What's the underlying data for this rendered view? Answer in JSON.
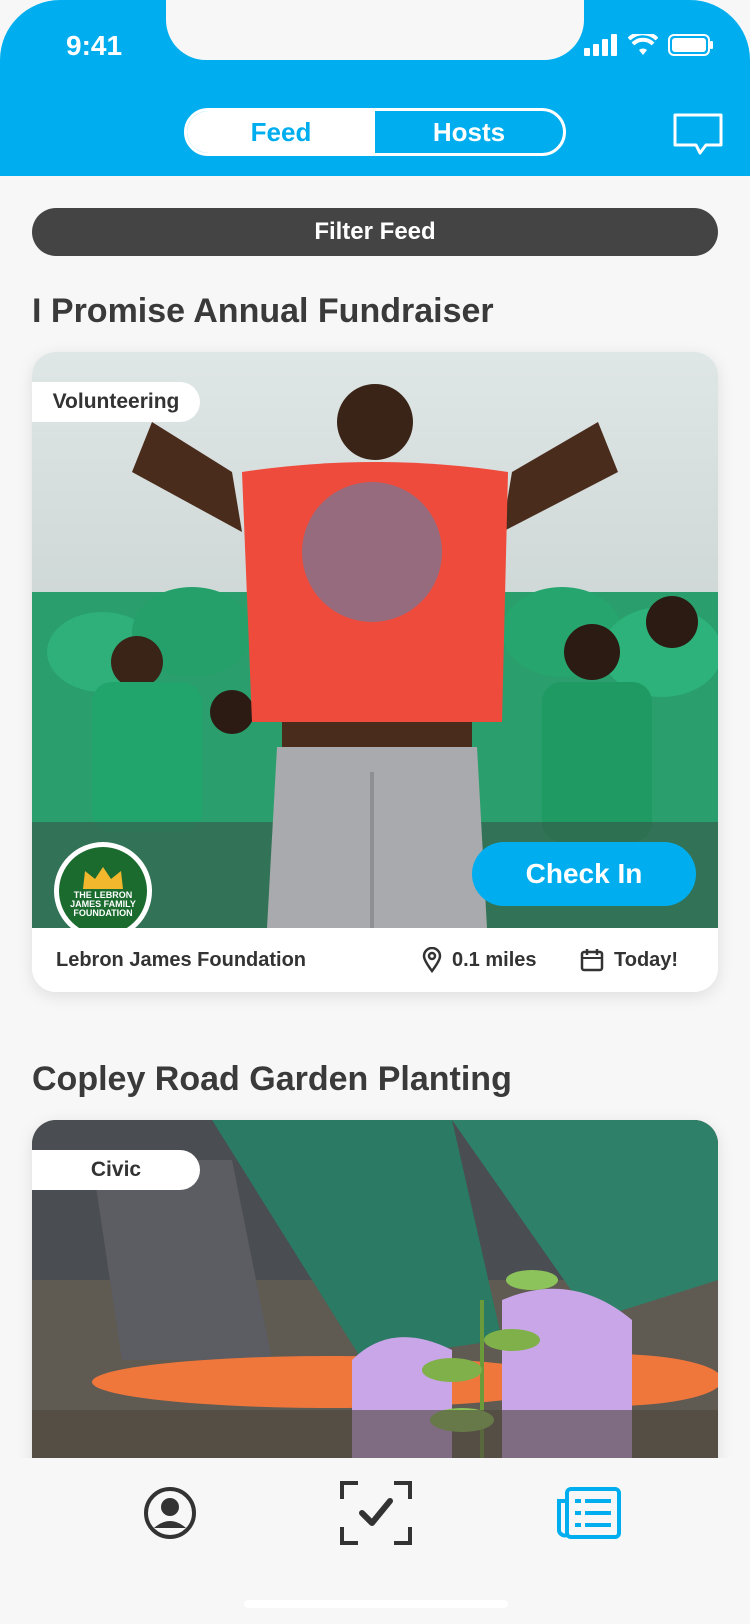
{
  "status_bar": {
    "time": "9:41"
  },
  "header": {
    "tabs": [
      {
        "label": "Feed",
        "active": true
      },
      {
        "label": "Hosts",
        "active": false
      }
    ],
    "message_icon": "chat-bubble-icon",
    "accent_color": "#00aeef"
  },
  "filter": {
    "label": "Filter Feed"
  },
  "events": [
    {
      "title": "I Promise Annual Fundraiser",
      "category": "Volunteering",
      "host_logo_text": [
        "THE LEBRON",
        "JAMES FAMILY",
        "FOUNDATION"
      ],
      "check_in_label": "Check In",
      "host": "Lebron James Foundation",
      "distance": "0.1 miles",
      "date": "Today!"
    },
    {
      "title": "Copley Road Garden Planting",
      "category": "Civic"
    }
  ],
  "tabbar": {
    "items": [
      {
        "icon": "profile-icon",
        "active": false
      },
      {
        "icon": "check-in-scan-icon",
        "active": false
      },
      {
        "icon": "feed-list-icon",
        "active": true
      }
    ]
  }
}
